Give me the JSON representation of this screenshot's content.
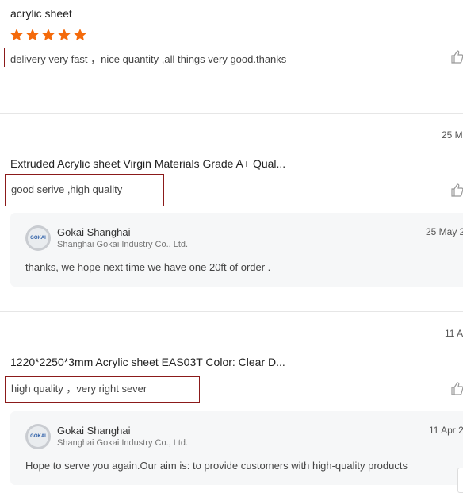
{
  "reviews": [
    {
      "product": "acrylic sheet",
      "rating": 5,
      "comment": "delivery very fast ，nice  quantity ,all things very good.thanks"
    },
    {
      "date": "25 M",
      "product": "Extruded Acrylic sheet Virgin Materials Grade A+ Qual...",
      "comment": "good serive  ,high quality",
      "reply": {
        "seller": "Gokai Shanghai",
        "company": "Shanghai Gokai Industry Co., Ltd.",
        "date": "25 May 2",
        "text": "thanks, we hope next time we have one 20ft of order ."
      }
    },
    {
      "date": "11 A",
      "product": "1220*2250*3mm Acrylic sheet EAS03T Color: Clear D...",
      "comment": "high quality  ，very right sever",
      "reply": {
        "seller": "Gokai Shanghai",
        "company": "Shanghai Gokai Industry Co., Ltd.",
        "date": "11 Apr 2",
        "text": "Hope to serve you again.Our aim is: to provide customers with high-quality products"
      }
    }
  ],
  "avatar_logo": "GOKAI",
  "colors": {
    "star": "#f46a0b",
    "highlight_border": "#8b1a1a"
  }
}
